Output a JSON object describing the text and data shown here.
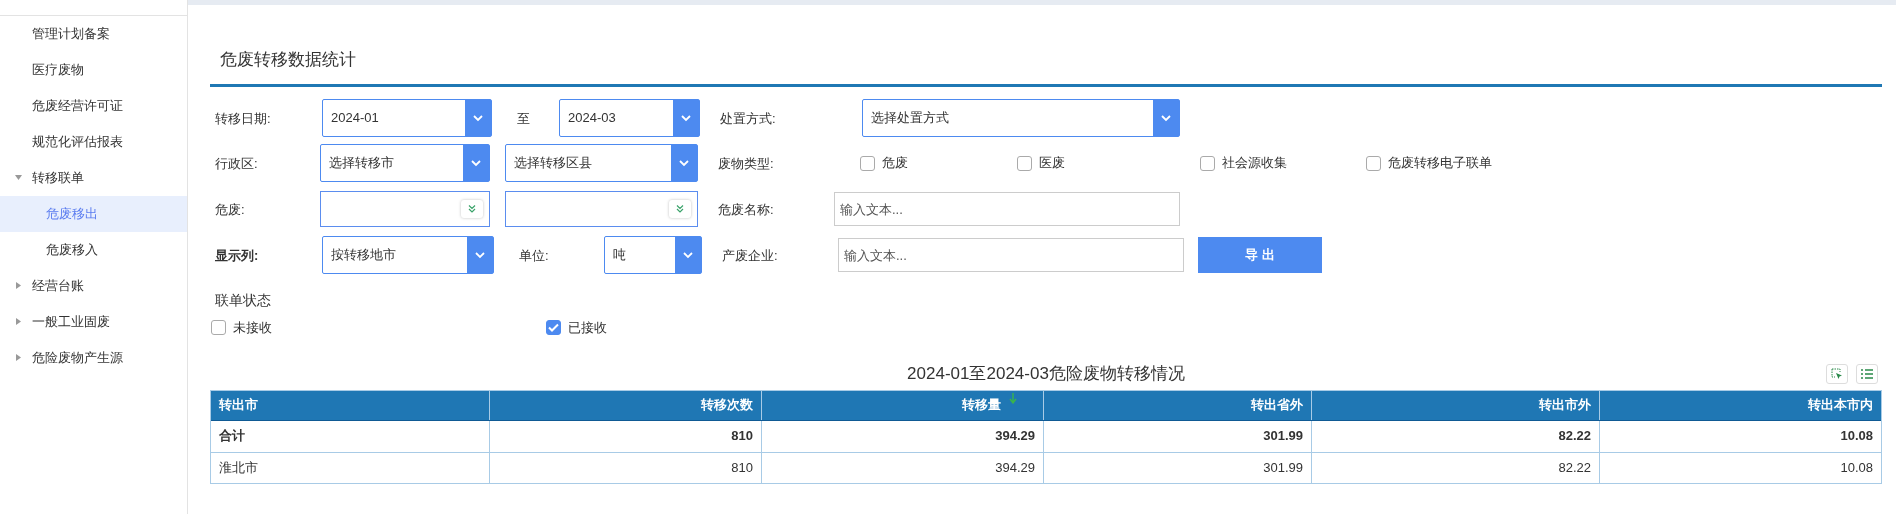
{
  "sidebar": {
    "items": [
      {
        "kind": "leaf",
        "label": "管理计划备案",
        "selected": false
      },
      {
        "kind": "leaf",
        "label": "医疗废物",
        "selected": false
      },
      {
        "kind": "leaf",
        "label": "危废经营许可证",
        "selected": false
      },
      {
        "kind": "leaf",
        "label": "规范化评估报表",
        "selected": false
      },
      {
        "kind": "group",
        "label": "转移联单",
        "selected": false,
        "expanded": true,
        "children": [
          {
            "kind": "leaf",
            "label": "危废移出",
            "selected": true
          },
          {
            "kind": "leaf",
            "label": "危废移入",
            "selected": false
          }
        ]
      },
      {
        "kind": "group",
        "label": "经营台账",
        "selected": false,
        "expanded": false
      },
      {
        "kind": "group",
        "label": "一般工业固废",
        "selected": false,
        "expanded": false
      },
      {
        "kind": "group",
        "label": "危险废物产生源",
        "selected": false,
        "expanded": false
      }
    ]
  },
  "page_title": "危废转移数据统计",
  "form": {
    "date": {
      "label": "转移日期:",
      "from": "2024-01",
      "separator": "至",
      "to": "2024-03"
    },
    "region": {
      "label": "行政区:",
      "city": "选择转移市",
      "county": "选择转移区县"
    },
    "hazard": {
      "label": "危废:"
    },
    "display": {
      "label": "显示列:",
      "value": "按转移地市",
      "unit_label": "单位:",
      "unit": "吨"
    },
    "disposal": {
      "label": "处置方式:",
      "value": "选择处置方式"
    },
    "waste_type": {
      "label": "废物类型:",
      "options": [
        {
          "label": "危废",
          "checked": false
        },
        {
          "label": "医废",
          "checked": false
        },
        {
          "label": "社会源收集",
          "checked": false
        },
        {
          "label": "危废转移电子联单",
          "checked": false
        }
      ]
    },
    "hazard_name": {
      "label": "危废名称:",
      "placeholder": "输入文本..."
    },
    "producer": {
      "label": "产废企业:",
      "placeholder": "输入文本..."
    },
    "export_button": "导 出",
    "status": {
      "label": "联单状态",
      "options": [
        {
          "label": "未接收",
          "checked": false
        },
        {
          "label": "已接收",
          "checked": true
        }
      ]
    }
  },
  "table": {
    "title": "2024-01至2024-03危险废物转移情况",
    "columns": [
      {
        "label": "转出市",
        "sorted": false
      },
      {
        "label": "转移次数",
        "sorted": false
      },
      {
        "label": "转移量",
        "sorted": true
      },
      {
        "label": "转出省外",
        "sorted": false
      },
      {
        "label": "转出市外",
        "sorted": false
      },
      {
        "label": "转出本市内",
        "sorted": false
      }
    ],
    "rows": [
      {
        "kind": "total",
        "cells": [
          "合计",
          "810",
          "394.29",
          "301.99",
          "82.22",
          "10.08"
        ]
      },
      {
        "kind": "normal",
        "cells": [
          "淮北市",
          "810",
          "394.29",
          "301.99",
          "82.22",
          "10.08"
        ]
      }
    ]
  }
}
